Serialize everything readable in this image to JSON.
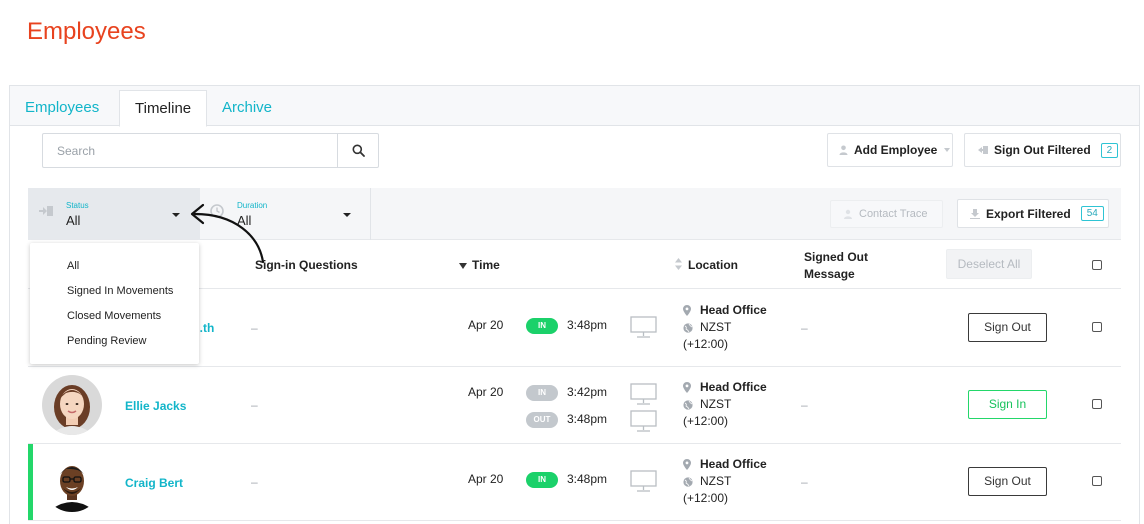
{
  "page": {
    "title": "Employees"
  },
  "tabs": [
    {
      "label": "Employees",
      "active": false
    },
    {
      "label": "Timeline",
      "active": true
    },
    {
      "label": "Archive",
      "active": false
    }
  ],
  "search": {
    "placeholder": "Search",
    "icon": "search-icon"
  },
  "toolbar": {
    "add_employee": "Add Employee",
    "sign_out_filtered": "Sign Out Filtered",
    "sign_out_filtered_count": "2",
    "contact_trace": "Contact Trace",
    "export_filtered": "Export Filtered",
    "export_filtered_count": "54"
  },
  "filters": {
    "status": {
      "label": "Status",
      "value": "All"
    },
    "duration": {
      "label": "Duration",
      "value": "All"
    }
  },
  "dropdown": {
    "items": [
      "All",
      "Signed In Movements",
      "Closed Movements",
      "Pending Review"
    ]
  },
  "columns": {
    "signin_questions": "Sign-in Questions",
    "time": "Time",
    "location": "Location",
    "signed_out_message_1": "Signed Out",
    "signed_out_message_2": "Message",
    "deselect_all": "Deselect All"
  },
  "rows": [
    {
      "name": "...th",
      "questions": "–",
      "date": "Apr 20",
      "movements": [
        {
          "badge": "IN",
          "time": "3:48pm"
        }
      ],
      "location": {
        "place": "Head Office",
        "tz": "NZST",
        "offset": "(+12:00)"
      },
      "message": "–",
      "action": "Sign Out"
    },
    {
      "name": "Ellie Jacks",
      "questions": "–",
      "date": "Apr 20",
      "movements": [
        {
          "badge": "IN",
          "time": "3:42pm"
        },
        {
          "badge": "OUT",
          "time": "3:48pm"
        }
      ],
      "location": {
        "place": "Head Office",
        "tz": "NZST",
        "offset": "(+12:00)"
      },
      "message": "–",
      "action": "Sign In"
    },
    {
      "name": "Craig Bert",
      "questions": "–",
      "date": "Apr 20",
      "movements": [
        {
          "badge": "IN",
          "time": "3:48pm"
        }
      ],
      "location": {
        "place": "Head Office",
        "tz": "NZST",
        "offset": "(+12:00)"
      },
      "message": "–",
      "action": "Sign Out"
    }
  ],
  "colors": {
    "accent": "#12b5c9",
    "title": "#e8431f",
    "in": "#1bd16a",
    "muted": "#c3c8cd"
  }
}
